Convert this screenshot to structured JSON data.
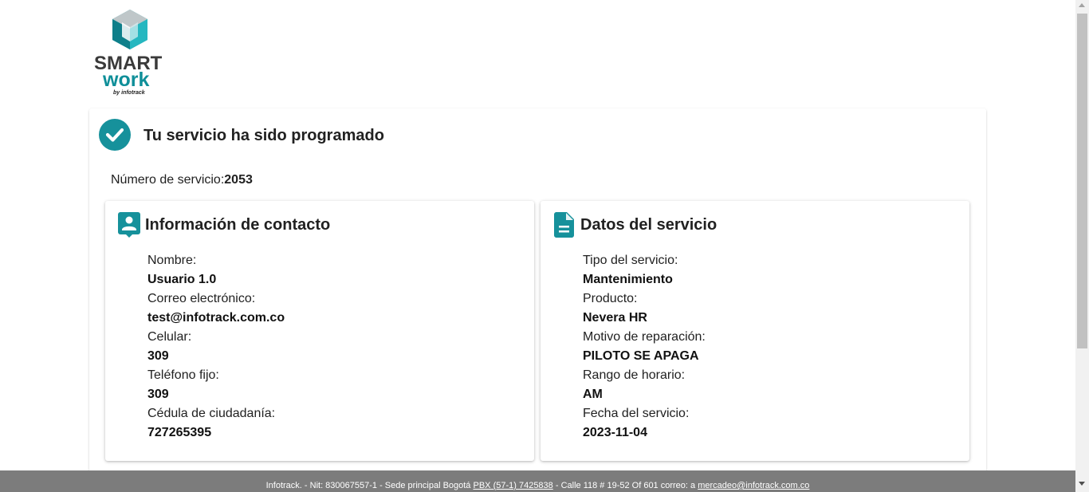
{
  "brand": {
    "line1": "SMART",
    "line2": "work",
    "byline": "by infotrack"
  },
  "confirmation": {
    "title": "Tu servicio ha sido programado",
    "service_number_label": "Número de servicio:",
    "service_number_value": "2053"
  },
  "contact": {
    "title": "Información de contacto",
    "fields": [
      {
        "label": "Nombre:",
        "value": "Usuario 1.0"
      },
      {
        "label": "Correo electrónico:",
        "value": "test@infotrack.com.co"
      },
      {
        "label": "Celular:",
        "value": "309"
      },
      {
        "label": "Teléfono fijo:",
        "value": "309"
      },
      {
        "label": "Cédula de ciudadanía:",
        "value": "727265395"
      }
    ]
  },
  "service": {
    "title": "Datos del servicio",
    "fields": [
      {
        "label": "Tipo del servicio:",
        "value": "Mantenimiento"
      },
      {
        "label": "Producto:",
        "value": "Nevera HR"
      },
      {
        "label": "Motivo de reparación:",
        "value": "PILOTO SE APAGA"
      },
      {
        "label": "Rango de horario:",
        "value": "AM"
      },
      {
        "label": "Fecha del servicio:",
        "value": "2023-11-04"
      }
    ]
  },
  "footer": {
    "text_1": "Infotrack. - Nit: 830067557-1 - Sede principal Bogotá",
    "phone_link": "PBX (57-1) 7425838",
    "text_2": "- Calle 118 # 19-52 Of 601   correo: a",
    "email_link": "mercadeo@infotrack.com.co"
  },
  "colors": {
    "accent": "#16919b",
    "footer_bg": "#7c7c7c"
  },
  "icons": {
    "status": "check-circle-icon",
    "contact": "contact-card-icon",
    "service": "document-icon"
  }
}
